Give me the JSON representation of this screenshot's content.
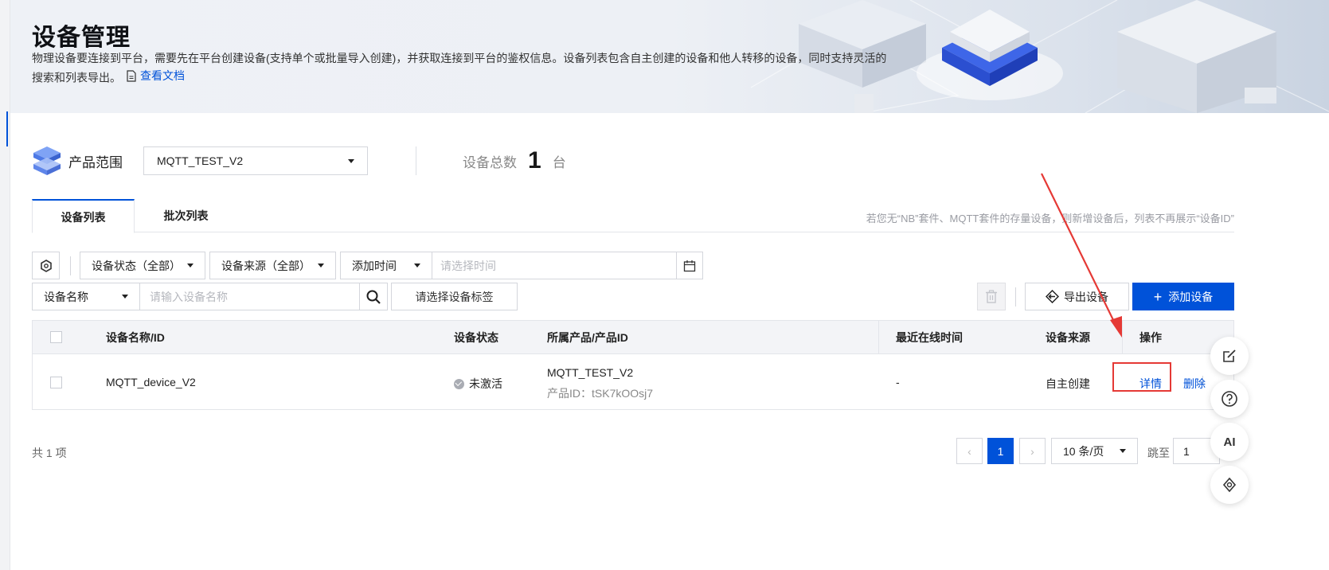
{
  "header": {
    "title": "设备管理",
    "description": "物理设备要连接到平台，需要先在平台创建设备(支持单个或批量导入创建)，并获取连接到平台的鉴权信息。设备列表包含自主创建的设备和他人转移的设备，同时支持灵活的搜索和列表导出。",
    "doc_link": "查看文档"
  },
  "scope": {
    "label": "产品范围",
    "product_selected": "MQTT_TEST_V2",
    "total_label": "设备总数",
    "total_count": "1",
    "total_unit": "台"
  },
  "tabs": [
    {
      "label": "设备列表",
      "active": true
    },
    {
      "label": "批次列表",
      "active": false
    }
  ],
  "tab_note": "若您无“NB”套件、MQTT套件的存量设备，则新增设备后，列表不再展示“设备ID”",
  "filters": {
    "status": "设备状态（全部）",
    "source": "设备来源（全部）",
    "time_type": "添加时间",
    "time_placeholder": "请选择时间",
    "name_type": "设备名称",
    "name_placeholder": "请输入设备名称",
    "tag_placeholder": "请选择设备标签"
  },
  "actions": {
    "export": "导出设备",
    "add": "添加设备"
  },
  "table": {
    "columns": [
      "设备名称/ID",
      "设备状态",
      "所属产品/产品ID",
      "最近在线时间",
      "设备来源",
      "操作"
    ],
    "rows": [
      {
        "name": "MQTT_device_V2",
        "status": "未激活",
        "product": "MQTT_TEST_V2",
        "product_id": "产品ID：tSK7kOOsj7",
        "last_online": "-",
        "source": "自主创建",
        "op_detail": "详情",
        "op_delete": "删除"
      }
    ]
  },
  "pagination": {
    "total": "共 1 项",
    "current_page": "1",
    "page_size": "10 条/页",
    "jump_label": "跳至",
    "jump_value": "1"
  },
  "float_tools": {
    "ai_label": "AI"
  },
  "colors": {
    "primary": "#0052d9",
    "annotation": "#e53935"
  }
}
